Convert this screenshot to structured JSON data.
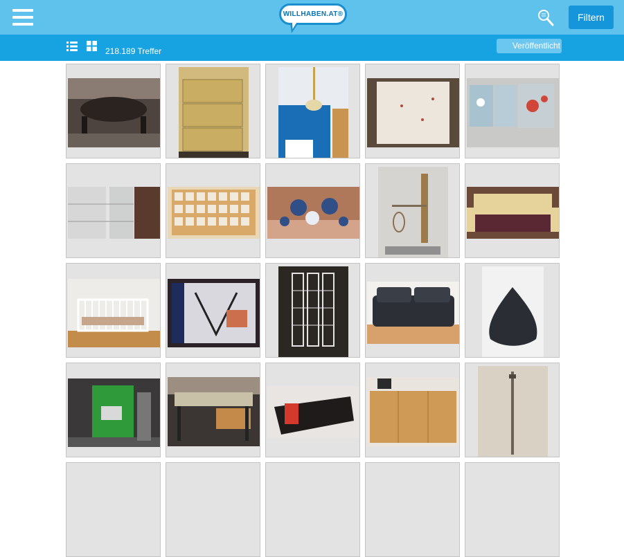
{
  "header": {
    "menu_icon": "hamburger-menu-icon",
    "logo_text": "WILLHABEN.AT®",
    "search_icon": "search-icon",
    "filter_label": "Filtern",
    "accent_color": "#5fc2ec",
    "button_color": "#1596db"
  },
  "toolbar": {
    "list_view_icon": "list-view-icon",
    "grid_view_icon": "grid-view-icon",
    "hits_text": "218.189 Treffer",
    "sort_label": "Veröffentlicht",
    "bar_color": "#17a3e1"
  },
  "listings": [
    {
      "name": "round-table-chairs"
    },
    {
      "name": "yellow-drawer-cabinet"
    },
    {
      "name": "ceiling-lamp"
    },
    {
      "name": "bed-cover"
    },
    {
      "name": "kitchen-panel-flowers"
    },
    {
      "name": "white-cabinets"
    },
    {
      "name": "wooden-shelf-compartments"
    },
    {
      "name": "porcelain-figures"
    },
    {
      "name": "brass-scale-device"
    },
    {
      "name": "cream-sofa"
    },
    {
      "name": "baby-crib"
    },
    {
      "name": "wall-clock-box"
    },
    {
      "name": "black-room-divider"
    },
    {
      "name": "dark-leather-sofa"
    },
    {
      "name": "bean-bag"
    },
    {
      "name": "green-boiler"
    },
    {
      "name": "wooden-desk"
    },
    {
      "name": "black-shelf-board"
    },
    {
      "name": "sideboard-cabinet"
    },
    {
      "name": "metal-rod"
    }
  ]
}
